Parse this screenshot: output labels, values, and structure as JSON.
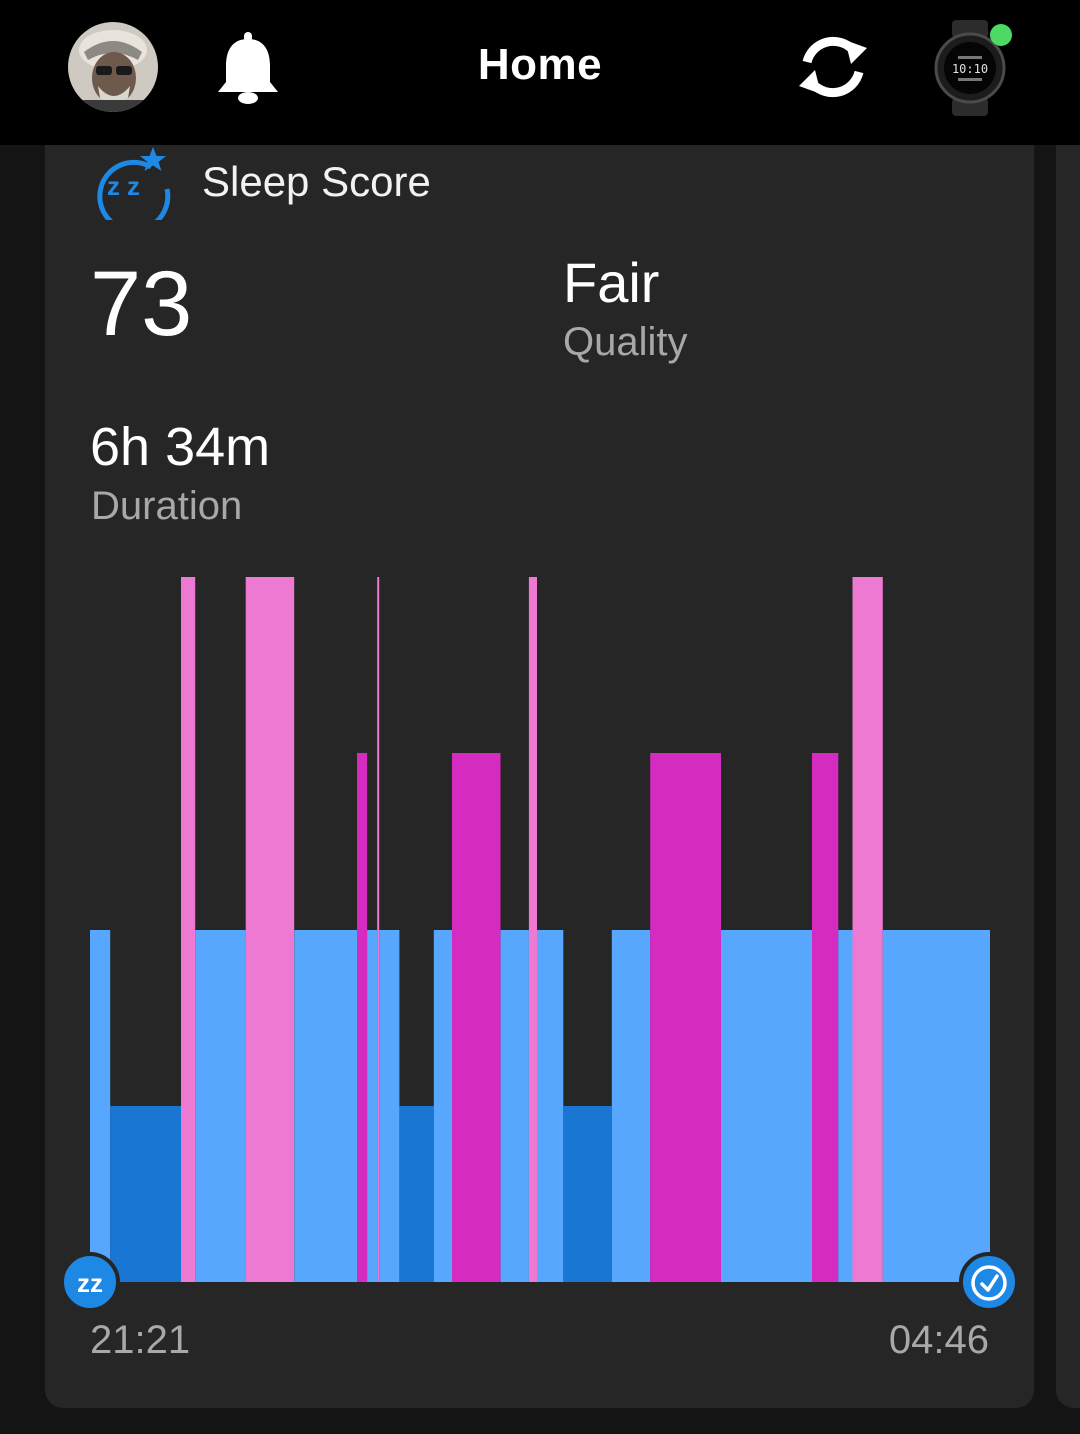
{
  "header": {
    "title": "Home",
    "avatar_icon": "profile-photo",
    "notifications_icon": "bell-icon",
    "sync_icon": "sync-icon",
    "device_icon": "watch-device-icon",
    "device_status": "connected"
  },
  "card": {
    "title": "Sleep Score",
    "icon": "sleep-score-icon",
    "score": "73",
    "quality_value": "Fair",
    "quality_label": "Quality",
    "duration_value": "6h 34m",
    "duration_label": "Duration",
    "start_time": "21:21",
    "end_time": "04:46",
    "start_marker_icon": "zz-icon",
    "end_marker_icon": "clock-icon"
  },
  "colors": {
    "deep": "#1976d2",
    "light": "#56a7fd",
    "rem": "#d52bc1",
    "awake": "#ee79d3",
    "accent": "#1e88e5"
  },
  "chart_data": {
    "type": "bar",
    "title": "",
    "xlabel": "",
    "ylabel": "",
    "x_range": [
      "21:21",
      "04:46"
    ],
    "total_minutes": 445,
    "levels": [
      "deep",
      "light",
      "rem",
      "awake"
    ],
    "segments": [
      {
        "stage": "light",
        "start": 0,
        "end": 10
      },
      {
        "stage": "deep",
        "start": 10,
        "end": 45
      },
      {
        "stage": "awake",
        "start": 45,
        "end": 52
      },
      {
        "stage": "light",
        "start": 52,
        "end": 77
      },
      {
        "stage": "awake",
        "start": 77,
        "end": 101
      },
      {
        "stage": "light",
        "start": 101,
        "end": 132
      },
      {
        "stage": "rem",
        "start": 132,
        "end": 137
      },
      {
        "stage": "light",
        "start": 137,
        "end": 142
      },
      {
        "stage": "awake",
        "start": 142,
        "end": 143
      },
      {
        "stage": "light",
        "start": 143,
        "end": 153
      },
      {
        "stage": "deep",
        "start": 153,
        "end": 170
      },
      {
        "stage": "light",
        "start": 170,
        "end": 179
      },
      {
        "stage": "rem",
        "start": 179,
        "end": 203
      },
      {
        "stage": "light",
        "start": 203,
        "end": 217
      },
      {
        "stage": "awake",
        "start": 217,
        "end": 221
      },
      {
        "stage": "light",
        "start": 221,
        "end": 234
      },
      {
        "stage": "deep",
        "start": 234,
        "end": 258
      },
      {
        "stage": "light",
        "start": 258,
        "end": 277
      },
      {
        "stage": "rem",
        "start": 277,
        "end": 312
      },
      {
        "stage": "light",
        "start": 312,
        "end": 357
      },
      {
        "stage": "rem",
        "start": 357,
        "end": 370
      },
      {
        "stage": "light",
        "start": 370,
        "end": 377
      },
      {
        "stage": "awake",
        "start": 377,
        "end": 392
      },
      {
        "stage": "light",
        "start": 392,
        "end": 445
      }
    ]
  }
}
